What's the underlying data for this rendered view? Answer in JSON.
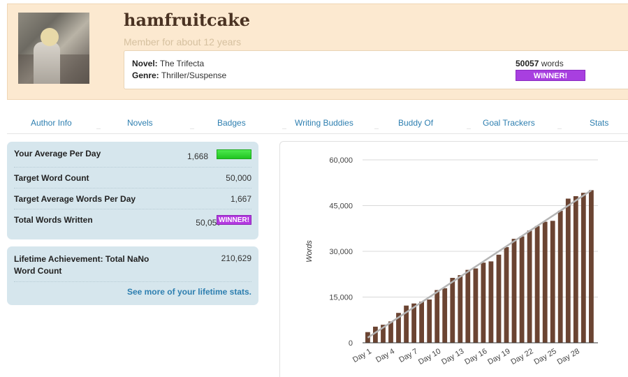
{
  "profile": {
    "username": "hamfruitcake",
    "member_since": "Member for about 12 years",
    "novel_label": "Novel:",
    "novel_title": "The Trifecta",
    "genre_label": "Genre:",
    "genre": "Thriller/Suspense",
    "word_count": "50057",
    "word_unit": "words",
    "winner_label": "WINNER!"
  },
  "tabs": [
    "Author Info",
    "Novels",
    "Badges",
    "Writing Buddies",
    "Buddy Of",
    "Goal Trackers",
    "Stats"
  ],
  "stats": {
    "avg_per_day_label": "Your Average Per Day",
    "avg_per_day": "1,668",
    "target_label": "Target Word Count",
    "target": "50,000",
    "target_avg_label": "Target Average Words Per Day",
    "target_avg": "1,667",
    "total_label": "Total Words Written",
    "total": "50,057",
    "winner_badge": "WINNER!",
    "avg_bar_fraction": 1.0
  },
  "lifetime": {
    "label": "Lifetime Achievement: Total NaNo Word Count",
    "value": "210,629",
    "link": "See more of your lifetime stats."
  },
  "colors": {
    "bar": "#6b4432",
    "target_line": "#b5b5b5",
    "winner": "#a83fe0",
    "link": "#2e7fb0",
    "card": "#d6e6ed",
    "header": "#fce9d0"
  },
  "chart_data": {
    "type": "bar",
    "ylabel": "Words",
    "xlabel": "",
    "ylim": [
      0,
      60000
    ],
    "yticks": [
      "0",
      "15,000",
      "30,000",
      "45,000",
      "60,000"
    ],
    "ytick_values": [
      0,
      15000,
      30000,
      45000,
      60000
    ],
    "categories": [
      "Day 1",
      "Day 2",
      "Day 3",
      "Day 4",
      "Day 5",
      "Day 6",
      "Day 7",
      "Day 8",
      "Day 9",
      "Day 10",
      "Day 11",
      "Day 12",
      "Day 13",
      "Day 14",
      "Day 15",
      "Day 16",
      "Day 17",
      "Day 18",
      "Day 19",
      "Day 20",
      "Day 21",
      "Day 22",
      "Day 23",
      "Day 24",
      "Day 25",
      "Day 26",
      "Day 27",
      "Day 28",
      "Day 29",
      "Day 30"
    ],
    "xtick_labels": [
      "Day 1",
      "Day 4",
      "Day 7",
      "Day 10",
      "Day 13",
      "Day 16",
      "Day 19",
      "Day 22",
      "Day 25",
      "Day 28"
    ],
    "series": [
      {
        "name": "",
        "values": [
          3500,
          5300,
          5900,
          7000,
          9800,
          12200,
          12900,
          13500,
          14200,
          17300,
          17900,
          21300,
          22200,
          23900,
          24400,
          26300,
          26700,
          28900,
          31400,
          34100,
          34900,
          36800,
          38300,
          39700,
          40000,
          43300,
          47300,
          48100,
          49200,
          50057
        ]
      }
    ],
    "target_line": [
      1667,
      50000
    ],
    "grid": true,
    "legend": "none"
  }
}
